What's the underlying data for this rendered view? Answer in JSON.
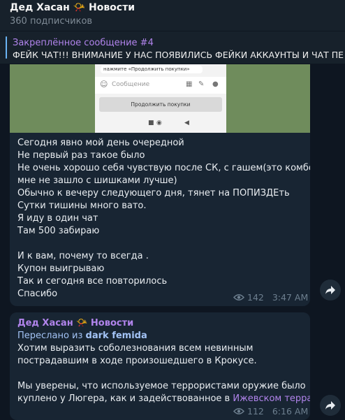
{
  "header": {
    "title": "Дед Хасан 📯 Новости",
    "subscribers": "360 подписчиков"
  },
  "pinned": {
    "title": "Закреплённое сообщение #4",
    "text": "ФЕЙК ЧАТ!!!  ВНИМАНИЕ У НАС ПОЯВИЛИСЬ ФЕЙКИ АККАУНТЫ И ЧАТ  ПЕ"
  },
  "message1": {
    "screenshot": {
      "hint": "нажмите «Продолжить покупки»",
      "input_placeholder": "Сообщение",
      "button_label": "Продолжить покупки"
    },
    "lines": [
      "Сегодня явно мой день очередной",
      "Не первый раз такое было",
      "Не очень хорошо себя чувствую после СК, с гашем(это комбо",
      "мне не зашло с шишками лучше)",
      "Обычно к вечеру следующего дня, тянет на ПОПИЗДЕть",
      "Сутки тишины много вато.",
      "Я иду в один чат",
      "Там 500 забираю",
      "",
      "И к вам, почему то всегда .",
      "Купон выигрываю",
      "Так и сегодня все повторилось",
      "Спасибо"
    ],
    "views": "142",
    "time": "3:47 AM"
  },
  "message2": {
    "author": "Дед Хасан 📯 Новости",
    "forwarded_prefix": "Переслано из",
    "forwarded_from": "dark femida",
    "lines": [
      "Хотим выразить соболезнования всем невинным",
      "пострадавшим в ходе произошедшего в Крокусе.",
      "",
      "Мы уверены, что используемое террористами оружие было"
    ],
    "last_line_prefix": "куплено у Люгера, как и задействованное в",
    "last_line_link": "Ижевском терракте",
    "last_line_suffix": ".",
    "views": "112",
    "time": "6:16 AM"
  },
  "colors": {
    "background": "#0e1621",
    "bubble": "#182533",
    "accent_purple": "#b184ec",
    "accent_blue": "#6ab3f3"
  },
  "icons": [
    "eye-icon",
    "forward-icon",
    "emoji-icon",
    "attach-icon"
  ]
}
